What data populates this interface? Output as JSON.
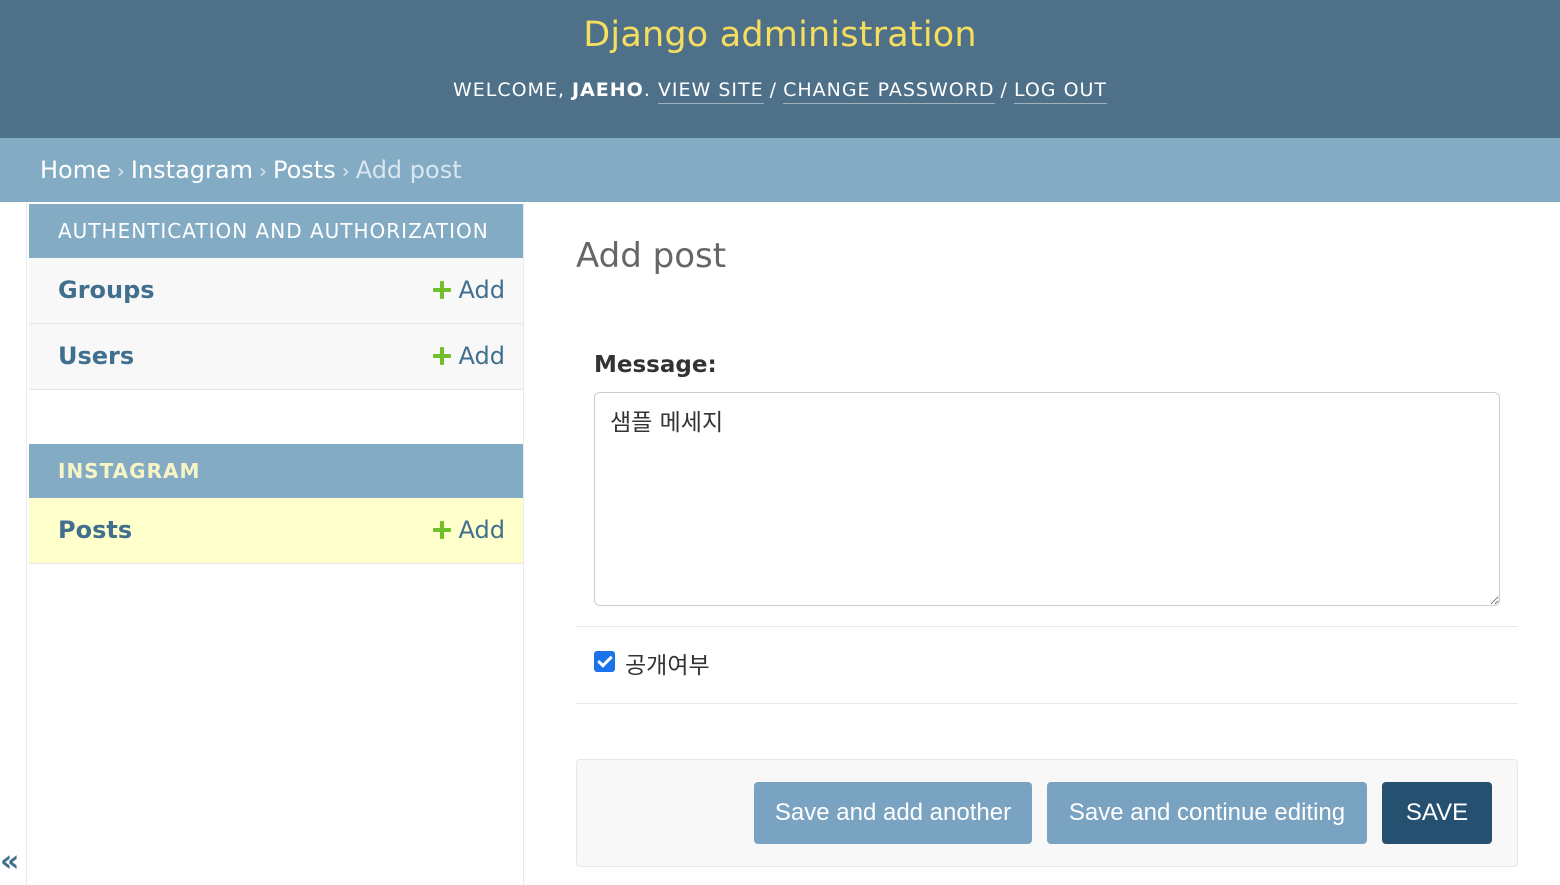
{
  "header": {
    "site_name": "Django administration",
    "welcome_prefix": "Welcome, ",
    "username": "jaeho",
    "view_site": "View site",
    "change_password": "Change password",
    "log_out": "Log out"
  },
  "breadcrumbs": {
    "home": "Home",
    "app": "Instagram",
    "model": "Posts",
    "current": "Add post",
    "separator": "›"
  },
  "sidebar": {
    "modules": [
      {
        "caption": "Authentication and Authorization",
        "models": [
          {
            "name": "Groups",
            "add": "Add"
          },
          {
            "name": "Users",
            "add": "Add"
          }
        ]
      },
      {
        "caption": "Instagram",
        "models": [
          {
            "name": "Posts",
            "add": "Add",
            "current": true
          }
        ]
      }
    ],
    "toggle": "«"
  },
  "content": {
    "title": "Add post",
    "fields": {
      "message_label": "Message:",
      "message_value": "샘플 메세지",
      "public_label": "공개여부",
      "public_checked": true
    }
  },
  "submit_row": {
    "save_add_another": "Save and add another",
    "save_continue": "Save and continue editing",
    "save": "Save"
  },
  "colors": {
    "header_bg": "#4e7189",
    "site_name": "#f5dd5d",
    "breadcrumbs_bg": "#84abc4",
    "link": "#41708f",
    "add_icon": "#70bf2b",
    "current_row_bg": "#ffffcc",
    "primary_button": "#265070",
    "secondary_button": "#79a3c1"
  }
}
